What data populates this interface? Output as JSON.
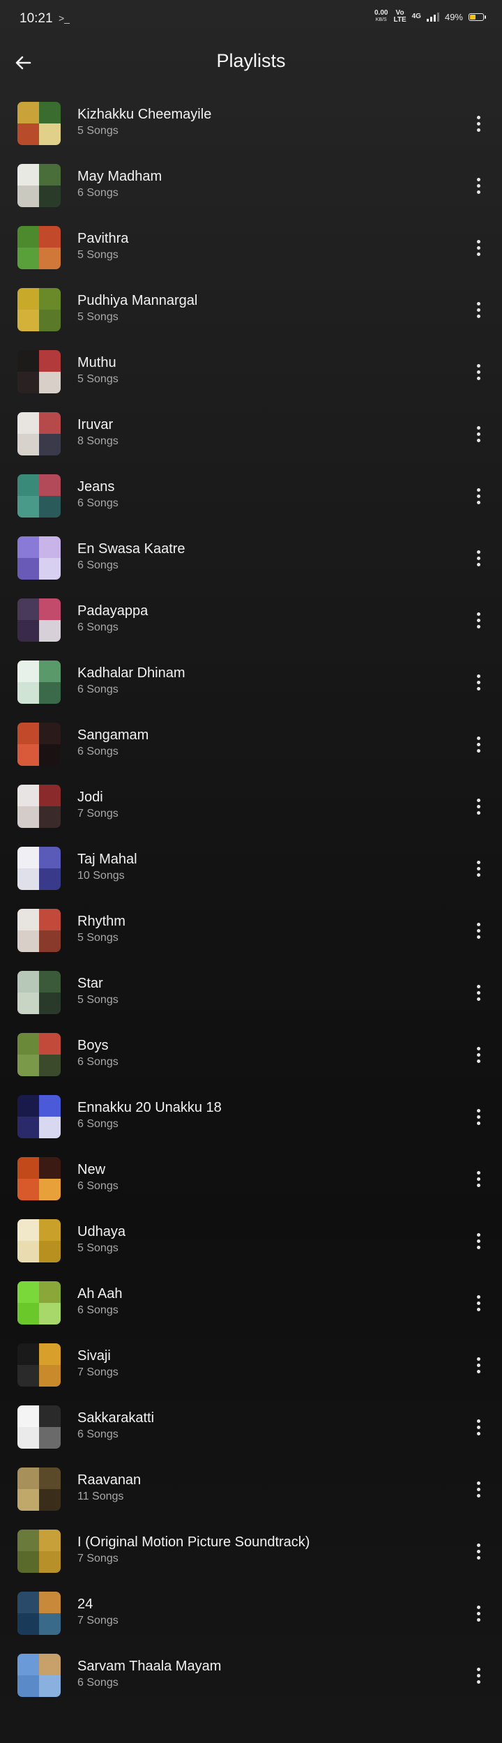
{
  "status_bar": {
    "time": "10:21",
    "terminal_glyph": ">_",
    "net_speed": "0.00",
    "net_unit": "KB/S",
    "sig1": "Vo",
    "sig1_sub": "LTE",
    "sig2": "4G",
    "battery_percent": "49%",
    "battery_level": 0.49,
    "battery_color": "#f3c21c"
  },
  "header": {
    "title": "Playlists",
    "back_icon": "arrow-left-icon"
  },
  "playlists": [
    {
      "name": "Kizhakku Cheemayile",
      "count": "5 Songs",
      "colors": [
        "#c9a23a",
        "#3a6b2f",
        "#b84b2a",
        "#e0d08a"
      ]
    },
    {
      "name": "May Madham",
      "count": "6 Songs",
      "colors": [
        "#e9e9e4",
        "#4a6e3a",
        "#c9c9c0",
        "#2b3b2a"
      ]
    },
    {
      "name": "Pavithra",
      "count": "5 Songs",
      "colors": [
        "#4c8a2d",
        "#c24a2a",
        "#5aa03a",
        "#d0783a"
      ]
    },
    {
      "name": "Pudhiya Mannargal",
      "count": "5 Songs",
      "colors": [
        "#c8a92a",
        "#6a8a2a",
        "#d4b23a",
        "#5a7a2a"
      ]
    },
    {
      "name": "Muthu",
      "count": "5 Songs",
      "colors": [
        "#1d1a1a",
        "#b23a3a",
        "#2a2222",
        "#d8d0c8"
      ]
    },
    {
      "name": "Iruvar",
      "count": "8 Songs",
      "colors": [
        "#e8e4e0",
        "#b64a4a",
        "#d8d2cc",
        "#3a3a4a"
      ]
    },
    {
      "name": "Jeans",
      "count": "6 Songs",
      "colors": [
        "#3a8a7a",
        "#b24a5a",
        "#4a9a8a",
        "#2a5a5a"
      ]
    },
    {
      "name": "En Swasa Kaatre",
      "count": "6 Songs",
      "colors": [
        "#8a7ad8",
        "#c8b4e8",
        "#6a5ab8",
        "#d8d0f0"
      ]
    },
    {
      "name": "Padayappa",
      "count": "6 Songs",
      "colors": [
        "#4a3a5a",
        "#c24a6a",
        "#3a2a4a",
        "#d8d0d8"
      ]
    },
    {
      "name": "Kadhalar Dhinam",
      "count": "6 Songs",
      "colors": [
        "#e8f0ea",
        "#5a9a6a",
        "#d0e4d6",
        "#3a6a4a"
      ]
    },
    {
      "name": "Sangamam",
      "count": "6 Songs",
      "colors": [
        "#c24a2a",
        "#2a1a1a",
        "#d85a3a",
        "#1a1212"
      ]
    },
    {
      "name": "Jodi",
      "count": "7 Songs",
      "colors": [
        "#e8e4e4",
        "#8a2a2a",
        "#d4ccc8",
        "#3a2a2a"
      ]
    },
    {
      "name": "Taj Mahal",
      "count": "10 Songs",
      "colors": [
        "#f0f0f4",
        "#5a5ab8",
        "#e0e0ea",
        "#3a3a8a"
      ]
    },
    {
      "name": "Rhythm",
      "count": "5 Songs",
      "colors": [
        "#e8e4e0",
        "#c24a3a",
        "#d8d0c8",
        "#8a3a2a"
      ]
    },
    {
      "name": "Star",
      "count": "5 Songs",
      "colors": [
        "#b8c8b8",
        "#3a5a3a",
        "#c8d4c4",
        "#2a3a2a"
      ]
    },
    {
      "name": "Boys",
      "count": "6 Songs",
      "colors": [
        "#6a8a3a",
        "#c24a3a",
        "#7a9a4a",
        "#3a4a2a"
      ]
    },
    {
      "name": "Ennakku 20 Unakku 18",
      "count": "6 Songs",
      "colors": [
        "#1a1a4a",
        "#4a5ad8",
        "#2a2a6a",
        "#d8d8f0"
      ]
    },
    {
      "name": "New",
      "count": "6 Songs",
      "colors": [
        "#c24a1a",
        "#3a1a12",
        "#d85a2a",
        "#e8a03a"
      ]
    },
    {
      "name": "Udhaya",
      "count": "5 Songs",
      "colors": [
        "#f0e8c8",
        "#c8a02a",
        "#e8dcb0",
        "#b89020"
      ]
    },
    {
      "name": "Ah Aah",
      "count": "6 Songs",
      "colors": [
        "#7ad83a",
        "#8aa83a",
        "#6ac82a",
        "#a8d86a"
      ]
    },
    {
      "name": "Sivaji",
      "count": "7 Songs",
      "colors": [
        "#1a1a1a",
        "#d8a02a",
        "#2a2a2a",
        "#c88a2a"
      ]
    },
    {
      "name": "Sakkarakatti",
      "count": "6 Songs",
      "colors": [
        "#f4f4f4",
        "#2a2a2a",
        "#eaeaea",
        "#6a6a6a"
      ]
    },
    {
      "name": "Raavanan",
      "count": "11 Songs",
      "colors": [
        "#a8905a",
        "#5a4a2a",
        "#c0a86a",
        "#3a2e1a"
      ]
    },
    {
      "name": "I (Original Motion Picture Soundtrack)",
      "count": "7 Songs",
      "colors": [
        "#6a7a3a",
        "#c8a03a",
        "#5a6a2a",
        "#b8902a"
      ]
    },
    {
      "name": "24",
      "count": "7 Songs",
      "colors": [
        "#2a4a6a",
        "#c88a3a",
        "#1a3a5a",
        "#3a6a8a"
      ]
    },
    {
      "name": "Sarvam Thaala Mayam",
      "count": "6 Songs",
      "colors": [
        "#6a9ad8",
        "#c8a06a",
        "#5a8ac8",
        "#8ab0e0"
      ]
    }
  ],
  "more_icon": "more-vertical-icon"
}
